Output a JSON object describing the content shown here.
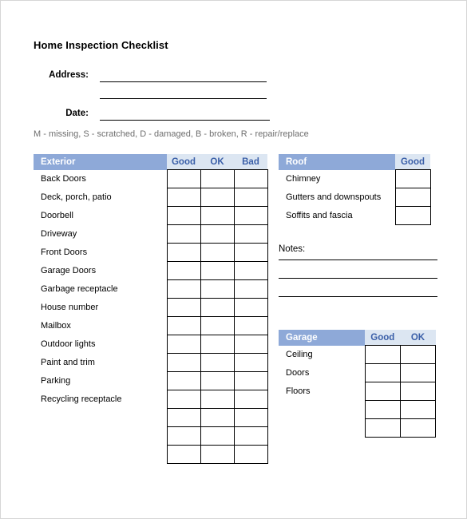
{
  "document": {
    "title": "Home Inspection Checklist"
  },
  "fields": {
    "address_label": "Address:",
    "date_label": "Date:"
  },
  "legend": {
    "items": [
      {
        "code": "M",
        "sep": " - ",
        "meaning": "missing,"
      },
      {
        "code": "S",
        "sep": " - ",
        "meaning": "scratched,"
      },
      {
        "code": "D",
        "sep": " - ",
        "meaning": "damaged,"
      },
      {
        "code": "B",
        "sep": " - ",
        "meaning": "broken,"
      },
      {
        "code": "R",
        "sep": " - ",
        "meaning": "repair/replace"
      }
    ],
    "full_text": "M - missing,  S - scratched,  D - damaged,  B - broken,  R - repair/replace"
  },
  "tables": {
    "exterior": {
      "title": "Exterior",
      "columns": [
        "Good",
        "OK",
        "Bad"
      ],
      "rows": [
        "Back Doors",
        "Deck, porch, patio",
        "Doorbell",
        "Driveway",
        "Front Doors",
        "Garage Doors",
        "Garbage receptacle",
        "House number",
        "Mailbox",
        "Outdoor lights",
        "Paint and trim",
        "Parking",
        "Recycling receptacle",
        "",
        "",
        ""
      ]
    },
    "roof": {
      "title": "Roof",
      "columns": [
        "Good"
      ],
      "rows": [
        "Chimney",
        "Gutters and downspouts",
        "Soffits and fascia"
      ]
    },
    "garage": {
      "title": "Garage",
      "columns": [
        "Good",
        "OK"
      ],
      "rows": [
        "Ceiling",
        "Doors",
        "Floors",
        "",
        ""
      ]
    }
  },
  "notes": {
    "label": "Notes:",
    "line_count": 3
  },
  "colors": {
    "header_name_bg": "#8ea9d8",
    "header_col_bg": "#dce6f2",
    "header_col_text": "#3a5fa8",
    "legend_text": "#6e6e6e",
    "page_border": "#d6d6d6"
  }
}
